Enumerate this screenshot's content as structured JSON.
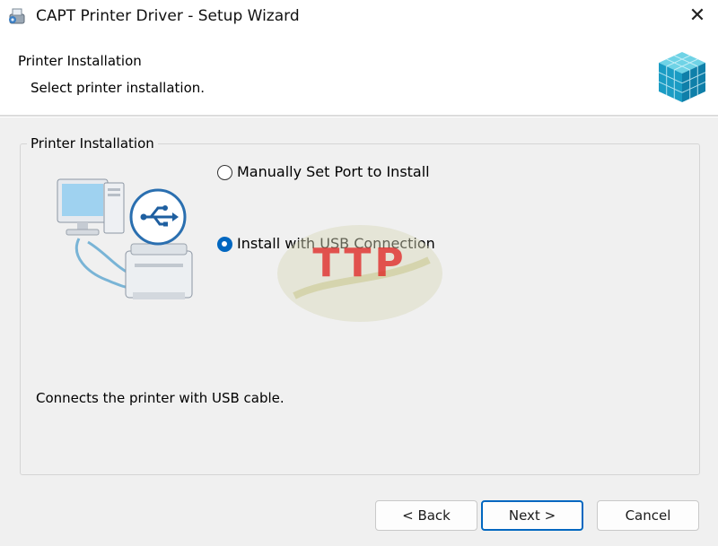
{
  "window": {
    "title": "CAPT Printer Driver - Setup Wizard",
    "close_label": "✕"
  },
  "header": {
    "title": "Printer Installation",
    "subtitle": "Select printer installation."
  },
  "group": {
    "label": "Printer Installation",
    "options": [
      {
        "label": "Manually Set Port to Install",
        "selected": false
      },
      {
        "label": "Install with USB Connection",
        "selected": true
      }
    ],
    "description": "Connects the printer with USB cable."
  },
  "watermark": {
    "text": "TTP",
    "color": "#e02020"
  },
  "buttons": {
    "back": "< Back",
    "next": "Next >",
    "cancel": "Cancel"
  },
  "colors": {
    "accent": "#0067c0",
    "header_bg": "#ffffff",
    "body_bg": "#f0f0f0"
  }
}
